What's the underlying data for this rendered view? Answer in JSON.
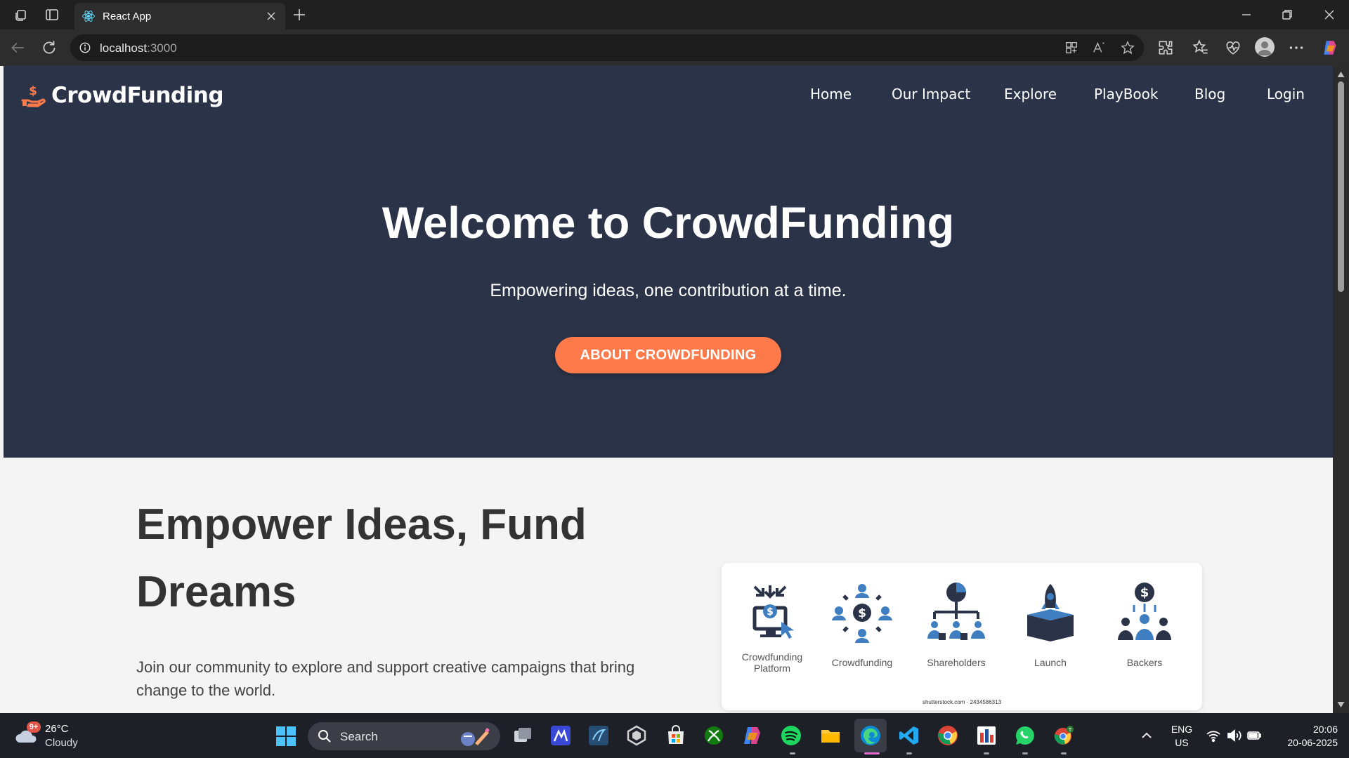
{
  "browser": {
    "tab_title": "React App",
    "url_host": "localhost",
    "url_port": ":3000"
  },
  "site": {
    "brand": "CrowdFunding",
    "nav": [
      "Home",
      "Our Impact",
      "Explore",
      "PlayBook",
      "Blog",
      "Login"
    ],
    "hero_title": "Welcome to CrowdFunding",
    "hero_subtitle": "Empowering ideas, one contribution at a time.",
    "hero_button": "ABOUT CROWDFUNDING",
    "section_title": "Empower Ideas, Fund Dreams",
    "section_text": "Join our community to explore and support creative campaigns that bring change to the world.",
    "illustration": {
      "labels": [
        "Crowdfunding Platform",
        "Crowdfunding",
        "Shareholders",
        "Launch",
        "Backers"
      ],
      "credit": "shutterstock.com · 2434586313"
    }
  },
  "colors": {
    "hero_bg": "#2b3348",
    "accent": "#ff7a4a",
    "icon_blue": "#3f7fc1",
    "icon_dark": "#2b3348"
  },
  "taskbar": {
    "weather_badge": "9+",
    "temperature": "26°C",
    "condition": "Cloudy",
    "search_label": "Search",
    "lang_line1": "ENG",
    "lang_line2": "US",
    "time": "20:06",
    "date": "20-06-2025"
  }
}
